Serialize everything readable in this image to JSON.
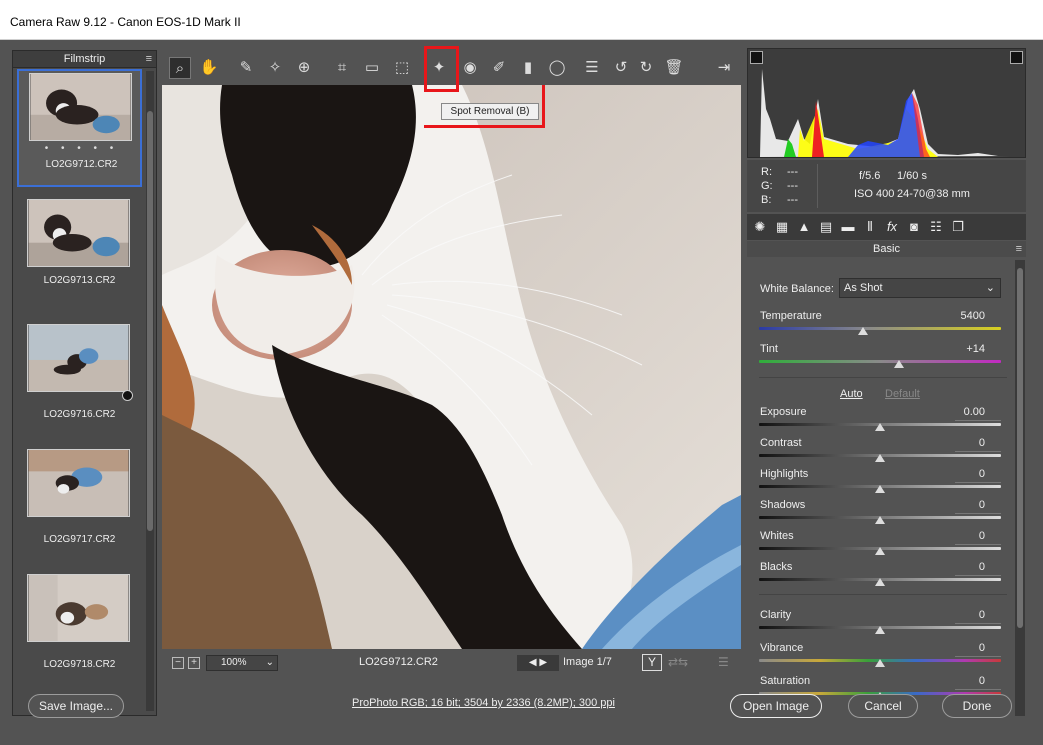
{
  "window": {
    "title": "Camera Raw 9.12  -  Canon EOS-1D Mark II"
  },
  "filmstrip": {
    "title": "Filmstrip",
    "menu_icon": "panel-menu-icon",
    "items": [
      {
        "label": "LO2G9712.CR2",
        "rating_dots": "• • • • •",
        "selected": true
      },
      {
        "label": "LO2G9713.CR2"
      },
      {
        "label": "LO2G9716.CR2",
        "has_adjustments_badge": true
      },
      {
        "label": "LO2G9717.CR2"
      },
      {
        "label": "LO2G9718.CR2"
      }
    ]
  },
  "toolbar": {
    "tools": [
      "zoom-tool-icon",
      "hand-tool-icon",
      "white-balance-tool-icon",
      "color-sampler-icon",
      "targeted-adjustment-icon",
      "crop-tool-icon",
      "straighten-tool-icon",
      "transform-tool-icon",
      "spot-removal-icon",
      "red-eye-icon",
      "adjustment-brush-icon",
      "graduated-filter-icon",
      "radial-filter-icon",
      "preferences-icon",
      "rotate-ccw-icon",
      "rotate-cw-icon",
      "trash-icon",
      "workflow-options-icon"
    ],
    "tooltip": "Spot Removal (B)"
  },
  "bottom_bar": {
    "zoom": "100%",
    "filename": "LO2G9712.CR2",
    "image_counter": "Image 1/7",
    "compare_label": "Y"
  },
  "histogram": {
    "readout": {
      "r_label": "R:",
      "r_val": "---",
      "g_label": "G:",
      "g_val": "---",
      "b_label": "B:",
      "b_val": "---"
    },
    "aperture": "f/5.6",
    "shutter": "1/60 s",
    "iso": "ISO 400",
    "lens": "24-70@38 mm"
  },
  "panel": {
    "title": "Basic",
    "white_balance_label": "White Balance:",
    "white_balance_value": "As Shot",
    "temperature": {
      "label": "Temperature",
      "value": "5400",
      "level": 0.43
    },
    "tint": {
      "label": "Tint",
      "value": "+14",
      "level": 0.58
    },
    "auto_label": "Auto",
    "default_label": "Default",
    "sliders": [
      {
        "label": "Exposure",
        "value": "0.00",
        "level": 0.5
      },
      {
        "label": "Contrast",
        "value": "0",
        "level": 0.5
      },
      {
        "label": "Highlights",
        "value": "0",
        "level": 0.5
      },
      {
        "label": "Shadows",
        "value": "0",
        "level": 0.5
      },
      {
        "label": "Whites",
        "value": "0",
        "level": 0.5
      },
      {
        "label": "Blacks",
        "value": "0",
        "level": 0.5
      }
    ],
    "presence": [
      {
        "label": "Clarity",
        "value": "0",
        "level": 0.5
      },
      {
        "label": "Vibrance",
        "value": "0",
        "level": 0.5
      },
      {
        "label": "Saturation",
        "value": "0",
        "level": 0.5
      }
    ]
  },
  "footer": {
    "save_label": "Save Image...",
    "workflow_link": "ProPhoto RGB; 16 bit; 3504 by 2336 (8.2MP); 300 ppi",
    "open_label": "Open Image",
    "cancel_label": "Cancel",
    "done_label": "Done"
  },
  "colors": {
    "selection_blue": "#3b6fd6",
    "highlight_red": "#e8161a"
  }
}
